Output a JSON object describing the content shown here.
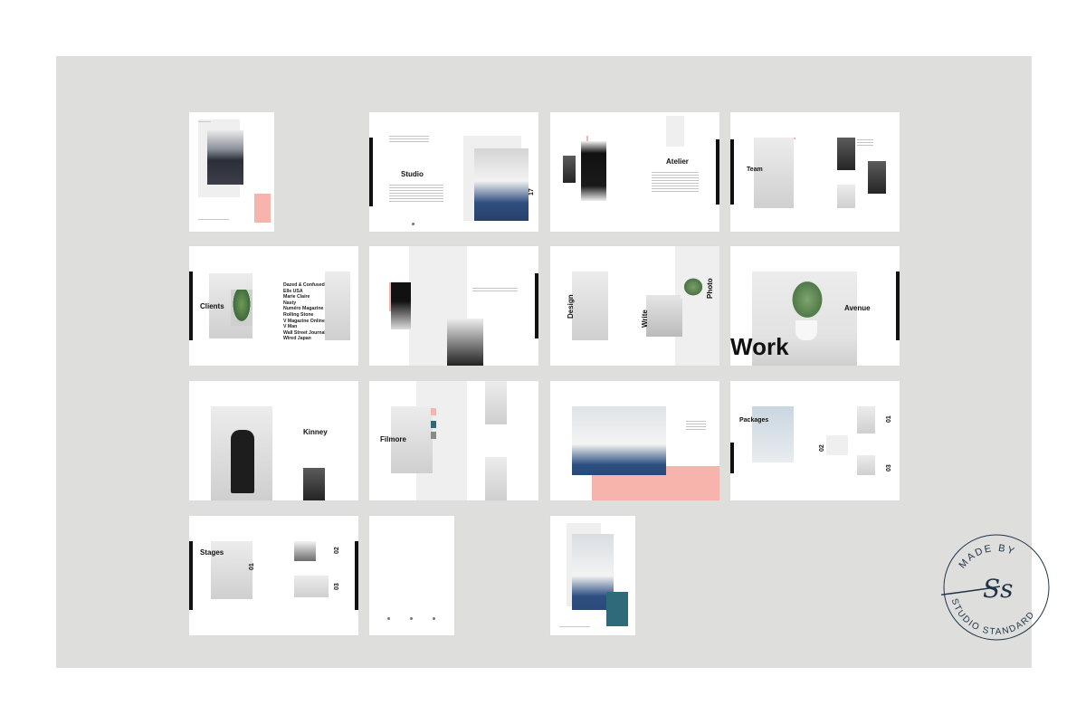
{
  "titles": {
    "studio": "Studio",
    "atelier": "Atelier",
    "team": "Team",
    "clients": "Clients",
    "design": "Design",
    "write": "Write",
    "photo": "Photo",
    "avenue": "Avenue",
    "work": "Work",
    "kinney": "Kinney",
    "filmore": "Filmore",
    "packages": "Packages",
    "stages": "Stages"
  },
  "numbers": {
    "n17": "17",
    "n01": "01",
    "n02": "02",
    "n03": "03",
    "p01": "01",
    "p02": "02",
    "p03": "03"
  },
  "clients_list": [
    "Dazed & Confused",
    "Elle USA",
    "Marie Claire",
    "Nasty",
    "Numéro Magazine",
    "Rolling Stone",
    "V Magazine Online",
    "V Man",
    "Wall Street Journal",
    "Wired Japan"
  ],
  "seal": {
    "top_text": "MADE BY",
    "bottom_text": "STUDIO STANDARD",
    "monogram": "Ss"
  },
  "colors": {
    "background": "#dededc",
    "pink": "#f6b4ac",
    "teal": "#2d6a7a",
    "seal_ink": "#1f3348"
  }
}
